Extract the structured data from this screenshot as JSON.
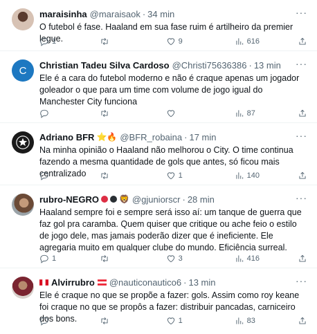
{
  "tweets": [
    {
      "name": "maraisinha",
      "handle": "@maraisaok",
      "time": "34 min",
      "text": "O futebol é fase. Haaland em sua fase ruim é artilheiro da premier legue.",
      "replies": "1",
      "retweets": "",
      "likes": "9",
      "views": "616"
    },
    {
      "name": "Christian Tadeu Silva Cardoso",
      "handle": "@Christi75636386",
      "time": "13 min",
      "avatar_letter": "C",
      "text": "Ele é a cara do futebol moderno e não é craque apenas um jogador goleador o que para um time com volume de jogo igual do Manchester City funciona",
      "replies": "",
      "retweets": "",
      "likes": "",
      "views": "87"
    },
    {
      "name": "Adriano BFR",
      "handle": "@BFR_robaina",
      "time": "17 min",
      "emojis": "⭐🔥",
      "text": "Na minha opinião o Haaland não melhorou o City. O time continua fazendo a mesma quantidade de gols que antes, só ficou mais centralizado",
      "replies": "",
      "retweets": "",
      "likes": "1",
      "views": "140"
    },
    {
      "name": "rubro-NEGRO",
      "handle": "@gjuniorscr",
      "time": "28 min",
      "emojis": "🦁",
      "text": "Haaland sempre foi e sempre será isso aí: um tanque de guerra que faz gol pra caramba. Quem quiser que critique ou ache feio o estilo de jogo dele, mas jamais poderão dizer que é ineficiente. Ele agregaria muito em qualquer clube do mundo. Eficiência surreal.",
      "replies": "1",
      "retweets": "",
      "likes": "3",
      "views": "416"
    },
    {
      "name": "Alvirrubro",
      "handle": "@nauticonautico6",
      "time": "13 min",
      "text": "Ele é craque no que se propõe a fazer: gols. Assim como roy keane foi craque no que se propôs a fazer: distribuir pancadas, carniceiro dos bons.",
      "replies": "",
      "retweets": "",
      "likes": "1",
      "views": "83"
    }
  ],
  "icons": {
    "more": "more-icon",
    "reply": "reply-icon",
    "retweet": "retweet-icon",
    "like": "heart-icon",
    "views": "views-icon",
    "share": "share-icon"
  },
  "colors": {
    "text": "#0f1419",
    "secondary": "#536471",
    "divider": "#eff3f4",
    "avatar_c": "#1d78c1"
  }
}
